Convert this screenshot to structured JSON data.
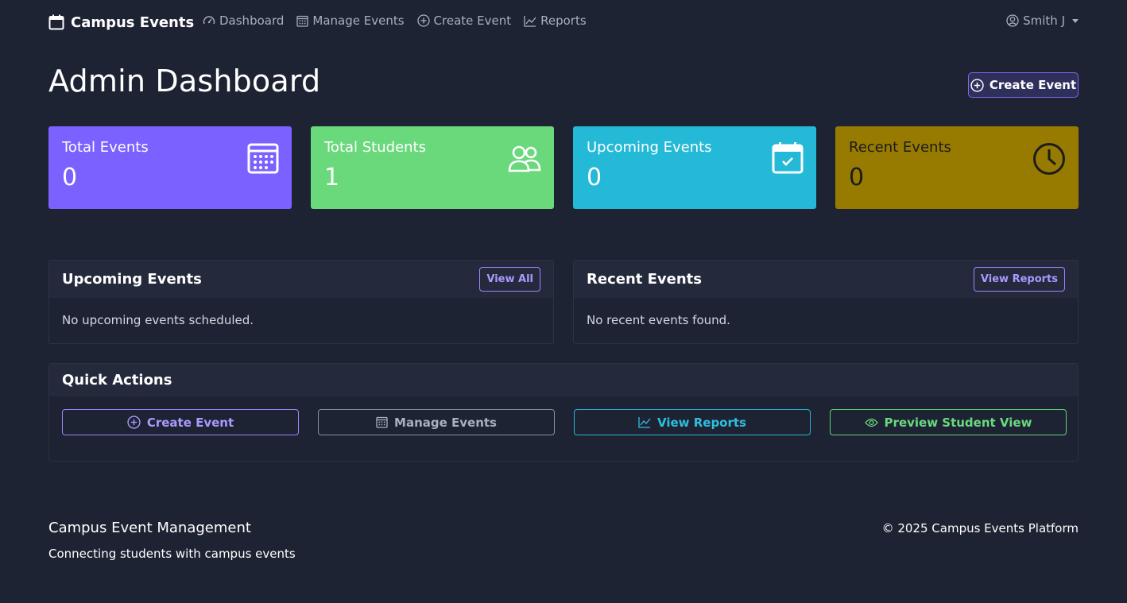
{
  "nav": {
    "brand": "Campus Events",
    "links": [
      {
        "label": "Dashboard",
        "icon": "speedometer-icon"
      },
      {
        "label": "Manage Events",
        "icon": "calendar-grid-icon"
      },
      {
        "label": "Create Event",
        "icon": "plus-circle-icon"
      },
      {
        "label": "Reports",
        "icon": "line-chart-icon"
      }
    ],
    "user": "Smith J"
  },
  "page": {
    "title": "Admin Dashboard",
    "create_button": "Create Event"
  },
  "stats": [
    {
      "label": "Total Events",
      "value": "0",
      "color": "#7b61ff",
      "icon": "calendar-grid-icon"
    },
    {
      "label": "Total Students",
      "value": "1",
      "color": "#69d97c",
      "icon": "people-icon"
    },
    {
      "label": "Upcoming Events",
      "value": "0",
      "color": "#25b9d8",
      "icon": "calendar-check-icon"
    },
    {
      "label": "Recent Events",
      "value": "0",
      "color": "#977a00",
      "icon": "clock-icon"
    }
  ],
  "upcoming": {
    "title": "Upcoming Events",
    "button": "View All",
    "empty_text": "No upcoming events scheduled."
  },
  "recent": {
    "title": "Recent Events",
    "button": "View Reports",
    "empty_text": "No recent events found."
  },
  "quick_actions": {
    "title": "Quick Actions",
    "buttons": [
      {
        "label": "Create Event",
        "icon": "plus-circle-icon",
        "color": "#a999ff"
      },
      {
        "label": "Manage Events",
        "icon": "calendar-grid-icon",
        "color": "#a9afbd"
      },
      {
        "label": "View Reports",
        "icon": "line-chart-icon",
        "color": "#2ebfdf"
      },
      {
        "label": "Preview Student View",
        "icon": "eye-icon",
        "color": "#6ad97e"
      }
    ]
  },
  "footer": {
    "title": "Campus Event Management",
    "tagline": "Connecting students with campus events",
    "copyright": "© 2025 Campus Events Platform"
  }
}
